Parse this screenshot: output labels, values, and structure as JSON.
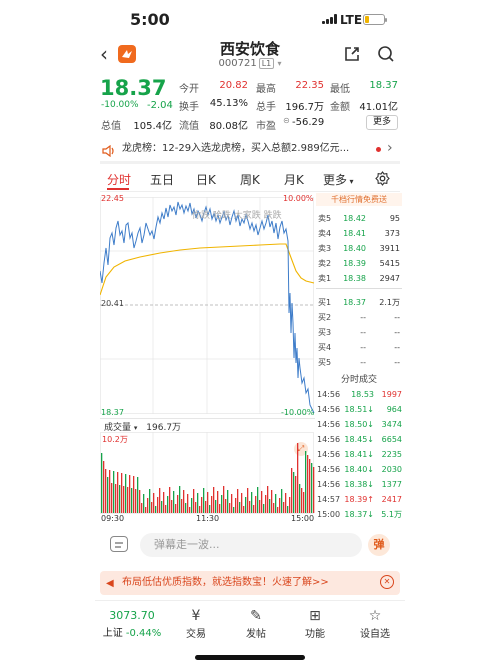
{
  "status_bar": {
    "time": "5:00",
    "network": "LTE"
  },
  "header": {
    "title": "西安饮食",
    "code": "000721",
    "level": "L1"
  },
  "quote": {
    "price": "18.37",
    "change_pct": "-10.00%",
    "change": "-2.04",
    "fields": [
      {
        "label": "今开",
        "value": "20.82",
        "color": "red"
      },
      {
        "label": "最高",
        "value": "22.35",
        "color": "red"
      },
      {
        "label": "最低",
        "value": "18.37",
        "color": "green"
      },
      {
        "label": "换手",
        "value": "45.13%",
        "color": "plain"
      },
      {
        "label": "总手",
        "value": "196.7万",
        "color": "plain"
      },
      {
        "label": "金额",
        "value": "41.01亿",
        "color": "plain"
      },
      {
        "label": "总值",
        "value": "105.4亿",
        "color": "plain"
      },
      {
        "label": "流值",
        "value": "80.08亿",
        "color": "plain"
      },
      {
        "label": "市盈",
        "value": "-56.29",
        "color": "plain"
      }
    ],
    "more_label": "更多"
  },
  "dragon": {
    "text": "龙虎榜：12-29入选龙虎榜，买入总额2.989亿元..."
  },
  "tabs": [
    "分时",
    "五日",
    "日K",
    "周K",
    "月K",
    "更多"
  ],
  "chart": {
    "high_label": "22.45",
    "high_pct": "10.00%",
    "mid_label": "20.41",
    "low_label": "18.37",
    "low_pct": "-10.00%",
    "watermark": "你跌 哈跌 大家跌 跌跌",
    "volume_label": "成交量",
    "volume_value": "196.7万",
    "volume_max": "10.2万",
    "time_start": "09:30",
    "time_mid": "11:30",
    "time_end": "15:00",
    "colors": {
      "up": "#e0312f",
      "down": "#16a34a",
      "price_line": "#3d7cc9",
      "avg_line": "#f0b400"
    }
  },
  "orderbook": {
    "header": "千档行情免费送",
    "asks": [
      {
        "label": "卖5",
        "price": "18.42",
        "qty": "95"
      },
      {
        "label": "卖4",
        "price": "18.41",
        "qty": "373"
      },
      {
        "label": "卖3",
        "price": "18.40",
        "qty": "3911"
      },
      {
        "label": "卖2",
        "price": "18.39",
        "qty": "5415"
      },
      {
        "label": "卖1",
        "price": "18.38",
        "qty": "2947"
      }
    ],
    "bids": [
      {
        "label": "买1",
        "price": "18.37",
        "qty": "2.1万"
      },
      {
        "label": "买2",
        "price": "--",
        "qty": "--"
      },
      {
        "label": "买3",
        "price": "--",
        "qty": "--"
      },
      {
        "label": "买4",
        "price": "--",
        "qty": "--"
      },
      {
        "label": "买5",
        "price": "--",
        "qty": "--"
      }
    ]
  },
  "trades": {
    "title": "分时成交",
    "rows": [
      {
        "time": "14:56",
        "price": "18.53",
        "dir": "",
        "qty": "1997",
        "qcolor": "red"
      },
      {
        "time": "14:56",
        "price": "18.51↓",
        "dir": "down",
        "qty": "964",
        "qcolor": "green"
      },
      {
        "time": "14:56",
        "price": "18.50↓",
        "dir": "down",
        "qty": "3474",
        "qcolor": "green"
      },
      {
        "time": "14:56",
        "price": "18.45↓",
        "dir": "down",
        "qty": "6654",
        "qcolor": "green"
      },
      {
        "time": "14:56",
        "price": "18.41↓",
        "dir": "down",
        "qty": "2235",
        "qcolor": "green"
      },
      {
        "time": "14:56",
        "price": "18.40↓",
        "dir": "down",
        "qty": "2030",
        "qcolor": "green"
      },
      {
        "time": "14:56",
        "price": "18.38↓",
        "dir": "down",
        "qty": "1377",
        "qcolor": "green"
      },
      {
        "time": "14:57",
        "price": "18.39↑",
        "dir": "up",
        "qty": "2417",
        "qcolor": "red"
      },
      {
        "time": "15:00",
        "price": "18.37↓",
        "dir": "down",
        "qty": "5.1万",
        "qcolor": "green"
      }
    ]
  },
  "danmu": {
    "placeholder": "弹幕走一波...",
    "send": "弹"
  },
  "banner": {
    "text": "布局低估优质指数，就选指数宝！火速了解>>"
  },
  "bottom_nav": {
    "index_value": "3073.70",
    "index_label": "上证",
    "index_pct": "-0.44%",
    "items": [
      "交易",
      "发帖",
      "功能",
      "设自选"
    ]
  }
}
